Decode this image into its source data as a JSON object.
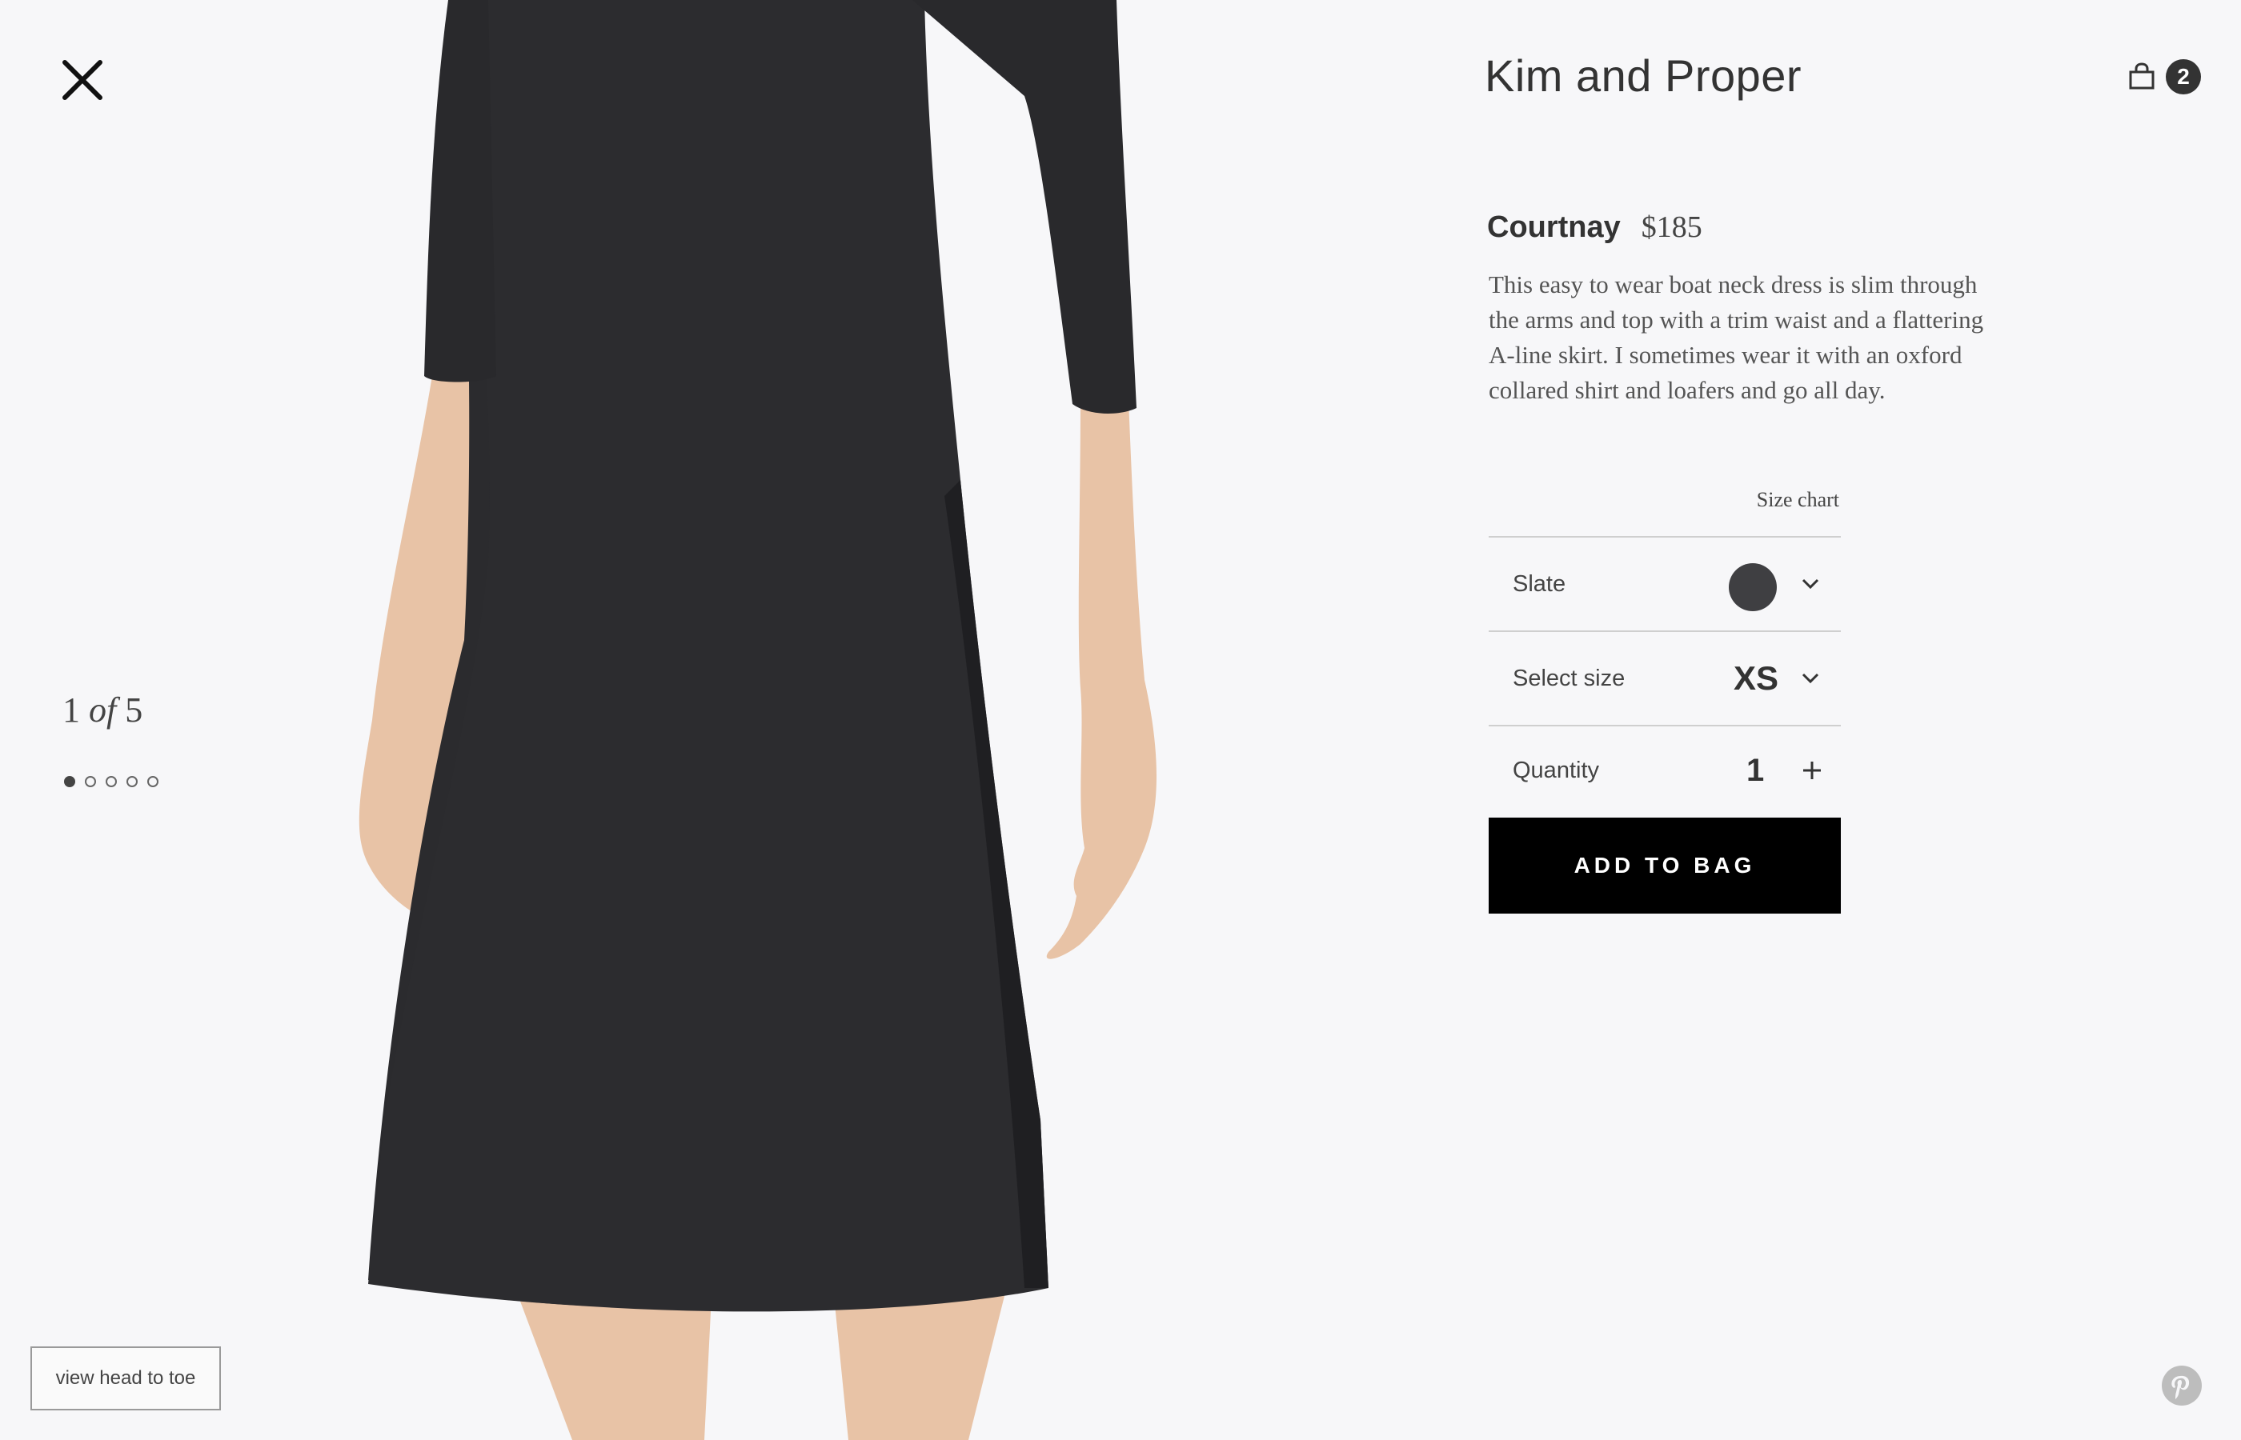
{
  "brand": "Kim and Proper",
  "bag": {
    "icon": "shopping-bag-icon",
    "count": "2"
  },
  "close": {
    "icon": "close-icon"
  },
  "gallery": {
    "current": "1",
    "of_word": "of",
    "total": "5",
    "dots": 5,
    "active_index": 0
  },
  "view_head_to_toe": "view head to toe",
  "product": {
    "name": "Courtnay",
    "price": "$185",
    "description": "This easy to wear boat neck dress is slim through the arms and top with a trim waist and a flattering A-line skirt. I sometimes wear it with an oxford collared shirt and loafers and go all day.",
    "size_chart": "Size chart",
    "color": {
      "label": "Slate",
      "swatch": "#3f3f42"
    },
    "size": {
      "label": "Select size",
      "value": "XS"
    },
    "quantity": {
      "label": "Quantity",
      "value": "1"
    },
    "add_to_bag": "ADD TO BAG"
  },
  "colors": {
    "background": "#f7f7f9",
    "button": "#000000",
    "dress": "#2b2b2e",
    "skin": "#e8c3a6"
  },
  "pinterest": {
    "icon": "pinterest-icon"
  }
}
